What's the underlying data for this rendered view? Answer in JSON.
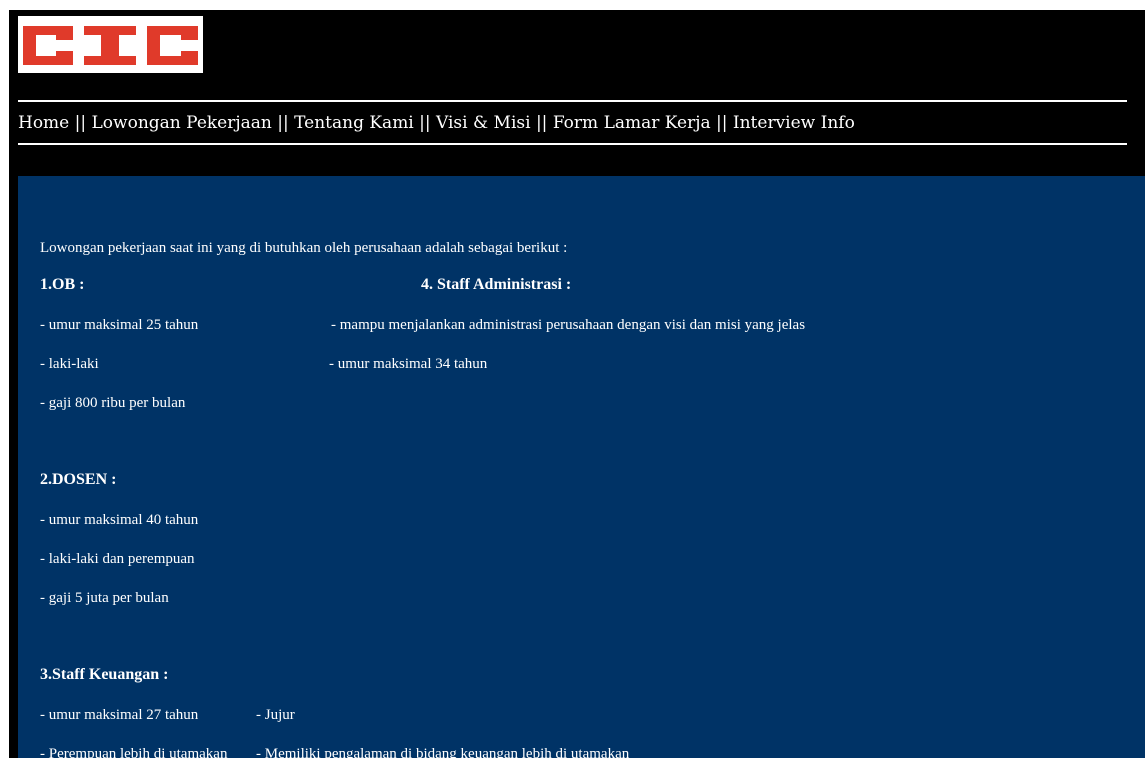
{
  "logo": {
    "text": "CIC",
    "color": "#e03a2a"
  },
  "nav": {
    "items": [
      {
        "label": "Home"
      },
      {
        "label": "Lowongan Pekerjaan"
      },
      {
        "label": "Tentang Kami"
      },
      {
        "label": "Visi & Misi"
      },
      {
        "label": "Form Lamar Kerja"
      },
      {
        "label": "Interview Info"
      }
    ],
    "separator": " || "
  },
  "content": {
    "intro": "Lowongan pekerjaan saat ini yang di butuhkan oleh perusahaan adalah sebagai berikut :",
    "jobs": {
      "ob": {
        "title": "1.OB :",
        "reqs": [
          "- umur maksimal 25 tahun",
          "- laki-laki",
          "- gaji 800 ribu per bulan"
        ]
      },
      "admin": {
        "title": "4. Staff Administrasi :",
        "reqs": [
          "- mampu menjalankan administrasi perusahaan dengan visi dan misi yang jelas",
          "- umur maksimal 34 tahun"
        ]
      },
      "dosen": {
        "title": "2.DOSEN :",
        "reqs": [
          "- umur maksimal 40 tahun",
          "- laki-laki dan perempuan",
          "- gaji 5 juta per bulan"
        ]
      },
      "keuangan": {
        "title": "3.Staff Keuangan :",
        "reqs": [
          "- umur maksimal 27 tahun",
          "- Perempuan lebih di utamakan"
        ],
        "reqs_right": [
          "- Jujur",
          "- Memiliki pengalaman di bidang keuangan lebih di utamakan"
        ]
      }
    }
  },
  "colors": {
    "header_bg": "#000000",
    "content_bg": "#003366",
    "text": "#ffffff",
    "logo_red": "#e03a2a"
  }
}
